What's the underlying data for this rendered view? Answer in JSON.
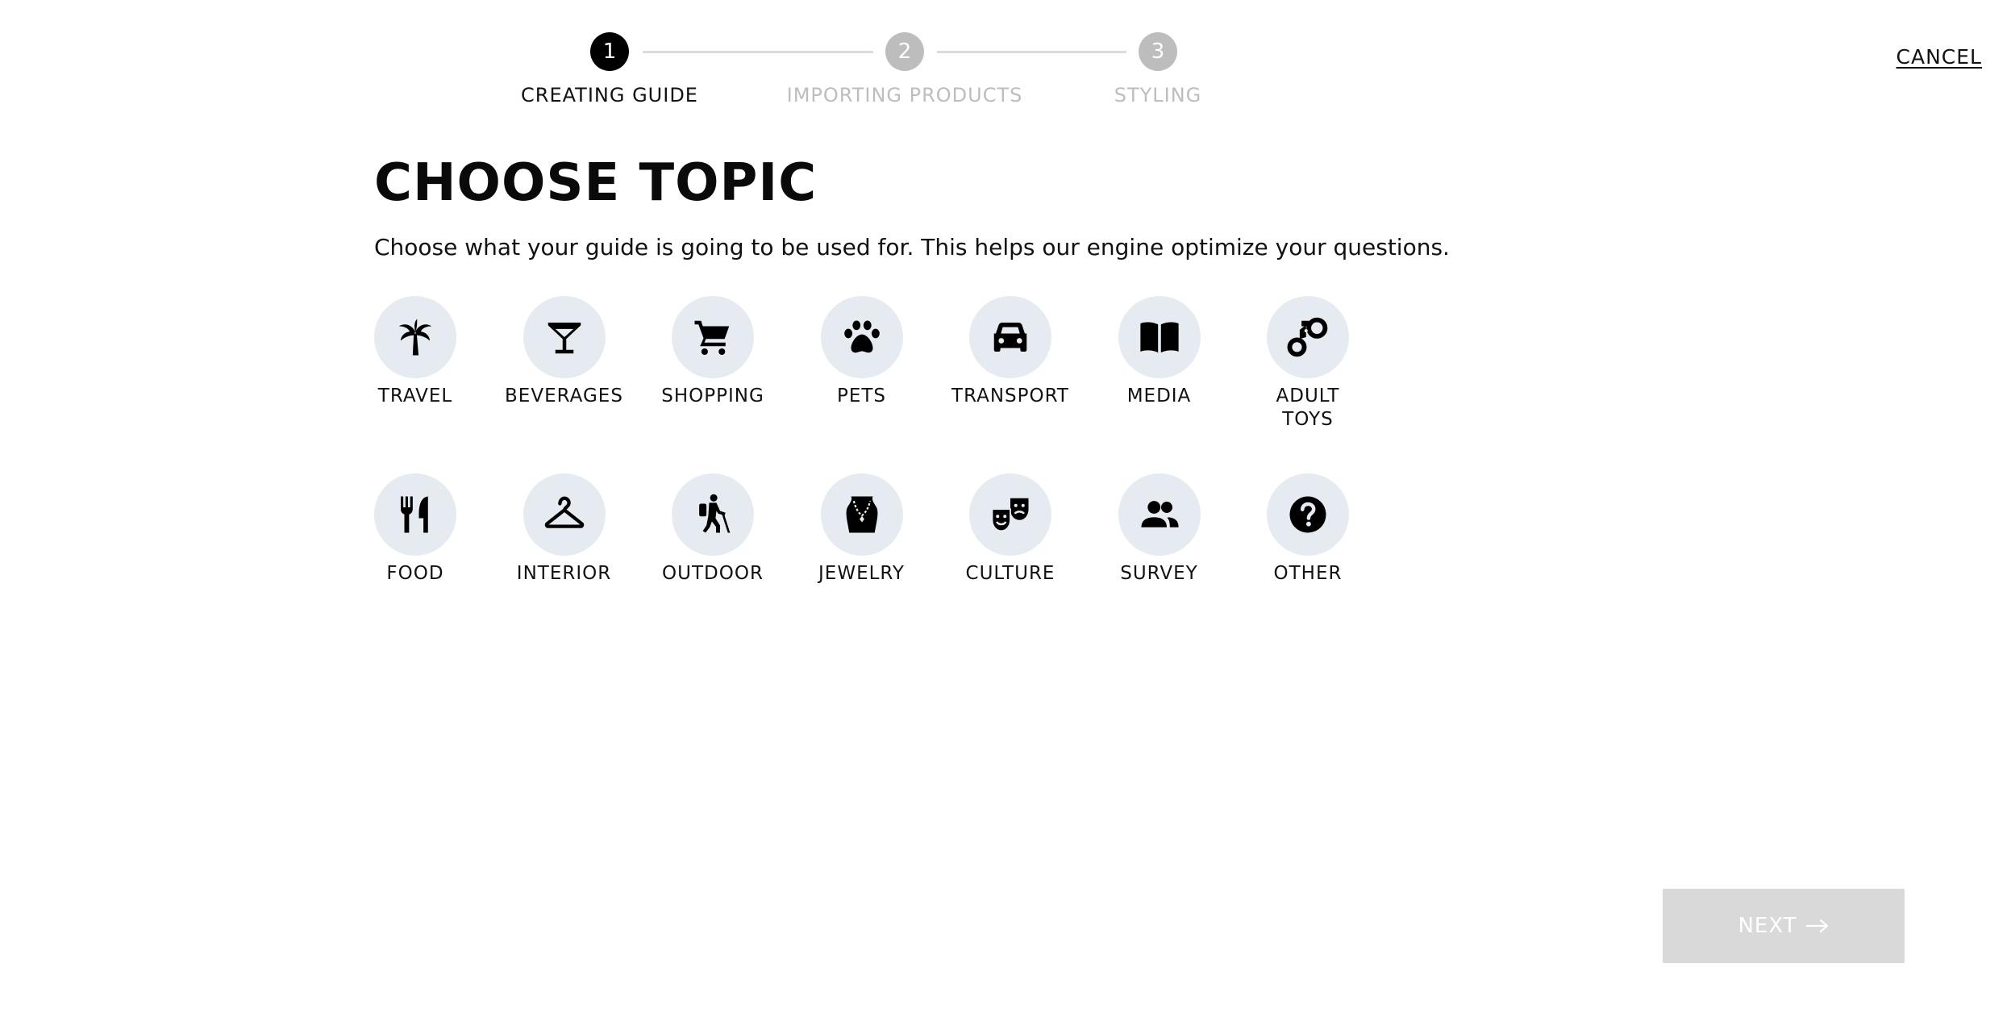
{
  "stepper": {
    "steps": [
      {
        "number": "1",
        "label": "CREATING GUIDE",
        "active": true
      },
      {
        "number": "2",
        "label": "IMPORTING PRODUCTS",
        "active": false
      },
      {
        "number": "3",
        "label": "STYLING",
        "active": false
      }
    ]
  },
  "header": {
    "cancel_label": "CANCEL"
  },
  "main": {
    "title": "CHOOSE TOPIC",
    "subtitle": "Choose what your guide is going to be used for. This helps our engine optimize your questions.",
    "topics": [
      {
        "label": "TRAVEL",
        "icon": "palm-tree-icon"
      },
      {
        "label": "BEVERAGES",
        "icon": "cocktail-glass-icon"
      },
      {
        "label": "SHOPPING",
        "icon": "shopping-cart-icon"
      },
      {
        "label": "PETS",
        "icon": "paw-icon"
      },
      {
        "label": "TRANSPORT",
        "icon": "car-icon"
      },
      {
        "label": "MEDIA",
        "icon": "book-icon"
      },
      {
        "label": "ADULT TOYS",
        "icon": "handcuffs-icon"
      },
      {
        "label": "FOOD",
        "icon": "fork-knife-icon"
      },
      {
        "label": "INTERIOR",
        "icon": "hanger-icon"
      },
      {
        "label": "OUTDOOR",
        "icon": "hiker-icon"
      },
      {
        "label": "JEWELRY",
        "icon": "necklace-icon"
      },
      {
        "label": "CULTURE",
        "icon": "theater-masks-icon"
      },
      {
        "label": "SURVEY",
        "icon": "people-icon"
      },
      {
        "label": "OTHER",
        "icon": "question-icon"
      }
    ]
  },
  "footer": {
    "next_label": "NEXT"
  },
  "colors": {
    "active_step": "#000000",
    "inactive_step": "#bdbdbd",
    "topic_circle": "#e5ebf1",
    "next_disabled_bg": "#d9d9d9"
  }
}
